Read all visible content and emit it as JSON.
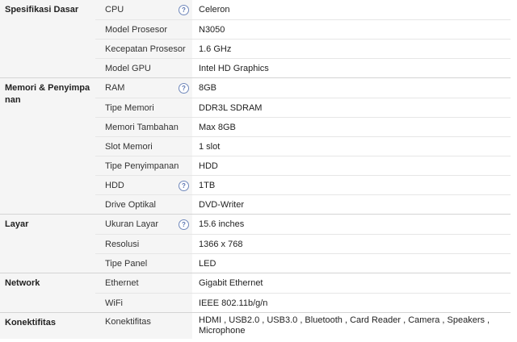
{
  "groups": [
    {
      "title": "Spesifikasi Dasar",
      "rows": [
        {
          "label": "CPU",
          "value": "Celeron",
          "help": true
        },
        {
          "label": "Model Prosesor",
          "value": "N3050",
          "help": false
        },
        {
          "label": "Kecepatan Prosesor",
          "value": "1.6 GHz",
          "help": false
        },
        {
          "label": "Model GPU",
          "value": "Intel HD Graphics",
          "help": false
        }
      ]
    },
    {
      "title": "Memori & Penyimpanan",
      "rows": [
        {
          "label": "RAM",
          "value": "8GB",
          "help": true
        },
        {
          "label": "Tipe Memori",
          "value": "DDR3L SDRAM",
          "help": false
        },
        {
          "label": "Memori Tambahan",
          "value": "Max 8GB",
          "help": false
        },
        {
          "label": "Slot Memori",
          "value": "1 slot",
          "help": false
        },
        {
          "label": "Tipe Penyimpanan",
          "value": "HDD",
          "help": false
        },
        {
          "label": "HDD",
          "value": "1TB",
          "help": true
        },
        {
          "label": "Drive Optikal",
          "value": "DVD-Writer",
          "help": false
        }
      ]
    },
    {
      "title": "Layar",
      "rows": [
        {
          "label": "Ukuran Layar",
          "value": "15.6 inches",
          "help": true
        },
        {
          "label": "Resolusi",
          "value": "1366 x 768",
          "help": false
        },
        {
          "label": "Tipe Panel",
          "value": "LED",
          "help": false
        }
      ]
    },
    {
      "title": "Network",
      "rows": [
        {
          "label": "Ethernet",
          "value": "Gigabit Ethernet",
          "help": false
        },
        {
          "label": "WiFi",
          "value": "IEEE 802.11b/g/n",
          "help": false
        }
      ]
    },
    {
      "title": "Konektifitas",
      "rows": [
        {
          "label": "Konektifitas",
          "value": "HDMI , USB2.0 , USB3.0 , Bluetooth , Card Reader , Camera , Speakers , Microphone",
          "help": false,
          "tall": true
        }
      ]
    }
  ],
  "help_glyph": "?",
  "help_icon": "question-circle-icon"
}
